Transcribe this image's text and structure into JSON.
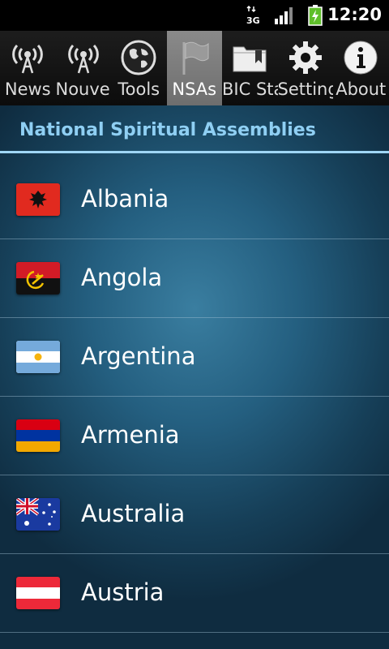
{
  "status_bar": {
    "network": "3G",
    "time": "12:20"
  },
  "tabs": [
    {
      "label": "News",
      "icon": "antenna-icon",
      "selected": false
    },
    {
      "label": "Nouvelles",
      "icon": "antenna-icon",
      "selected": false
    },
    {
      "label": "Tools",
      "icon": "globe-icon",
      "selected": false
    },
    {
      "label": "NSAs",
      "icon": "flag-icon",
      "selected": true
    },
    {
      "label": "BIC Statements",
      "icon": "folder-icon",
      "selected": false
    },
    {
      "label": "Settings",
      "icon": "gear-icon",
      "selected": false
    },
    {
      "label": "About",
      "icon": "info-icon",
      "selected": false
    }
  ],
  "list_header": "National Spiritual Assemblies",
  "countries": [
    {
      "name": "Albania",
      "flag": "albania-flag-icon"
    },
    {
      "name": "Angola",
      "flag": "angola-flag-icon"
    },
    {
      "name": "Argentina",
      "flag": "argentina-flag-icon"
    },
    {
      "name": "Armenia",
      "flag": "armenia-flag-icon"
    },
    {
      "name": "Australia",
      "flag": "australia-flag-icon"
    },
    {
      "name": "Austria",
      "flag": "austria-flag-icon"
    }
  ],
  "colors": {
    "header_text": "#8fcff3",
    "header_rule": "#9fd6f5",
    "tab_selected": "#7c7c7c"
  }
}
